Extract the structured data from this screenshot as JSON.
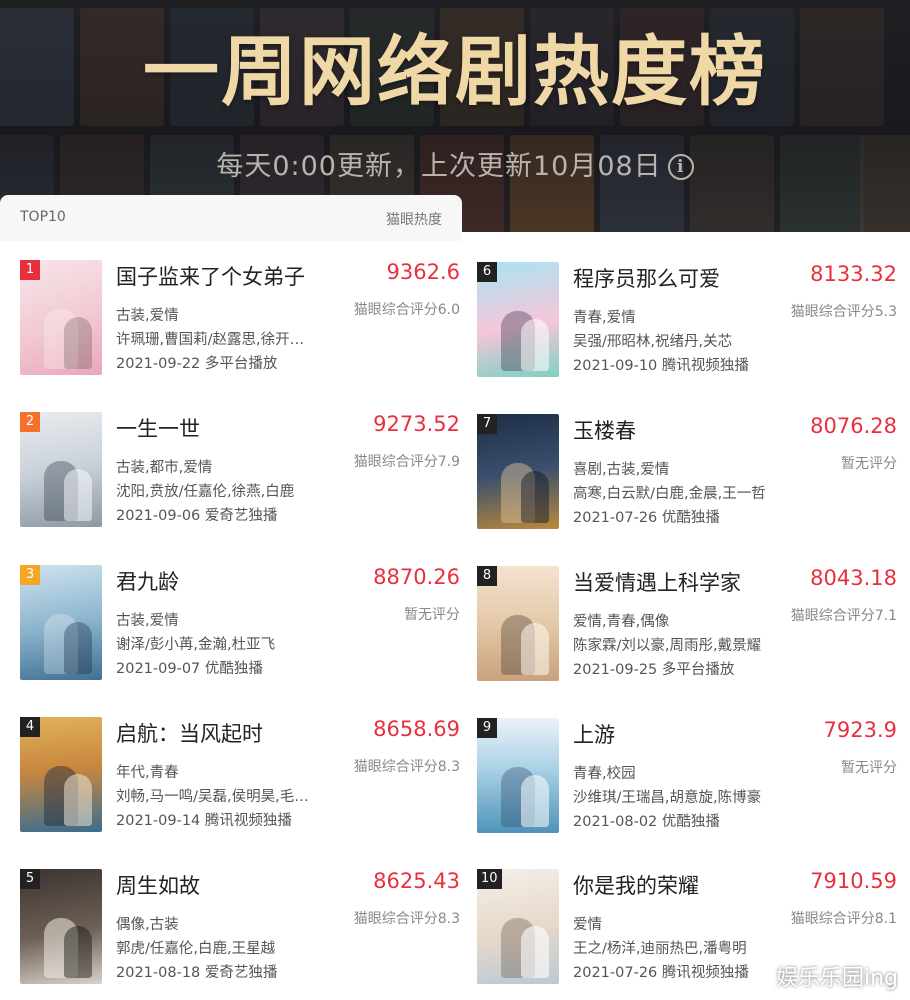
{
  "header": {
    "title": "一周网络剧热度榜",
    "subtitle": "每天0:00更新，上次更新10月08日"
  },
  "tab": {
    "label": "TOP10",
    "metric": "猫眼热度"
  },
  "items": [
    {
      "rank": "1",
      "title": "国子监来了个女弟子",
      "score": "9362.6",
      "rating": "猫眼综合评分6.0",
      "genre": "古装,爱情",
      "cast": "许珮珊,曹国莉/赵露思,徐开…",
      "release": "2021-09-22 多平台播放"
    },
    {
      "rank": "2",
      "title": "一生一世",
      "score": "9273.52",
      "rating": "猫眼综合评分7.9",
      "genre": "古装,都市,爱情",
      "cast": "沈阳,贲放/任嘉伦,徐燕,白鹿",
      "release": "2021-09-06 爱奇艺独播"
    },
    {
      "rank": "3",
      "title": "君九龄",
      "score": "8870.26",
      "rating": "暂无评分",
      "genre": "古装,爱情",
      "cast": "谢泽/彭小苒,金瀚,杜亚飞",
      "release": "2021-09-07 优酷独播"
    },
    {
      "rank": "4",
      "title": "启航：当风起时",
      "score": "8658.69",
      "rating": "猫眼综合评分8.3",
      "genre": "年代,青春",
      "cast": "刘畅,马一鸣/吴磊,侯明昊,毛…",
      "release": "2021-09-14 腾讯视频独播"
    },
    {
      "rank": "5",
      "title": "周生如故",
      "score": "8625.43",
      "rating": "猫眼综合评分8.3",
      "genre": "偶像,古装",
      "cast": "郭虎/任嘉伦,白鹿,王星越",
      "release": "2021-08-18 爱奇艺独播"
    },
    {
      "rank": "6",
      "title": "程序员那么可爱",
      "score": "8133.32",
      "rating": "猫眼综合评分5.3",
      "genre": "青春,爱情",
      "cast": "吴强/邢昭林,祝绪丹,关芯",
      "release": "2021-09-10 腾讯视频独播"
    },
    {
      "rank": "7",
      "title": "玉楼春",
      "score": "8076.28",
      "rating": "暂无评分",
      "genre": "喜剧,古装,爱情",
      "cast": "高寒,白云默/白鹿,金晨,王一哲",
      "release": "2021-07-26 优酷独播"
    },
    {
      "rank": "8",
      "title": "当爱情遇上科学家",
      "score": "8043.18",
      "rating": "猫眼综合评分7.1",
      "genre": "爱情,青春,偶像",
      "cast": "陈家霖/刘以豪,周雨彤,戴景耀",
      "release": "2021-09-25 多平台播放"
    },
    {
      "rank": "9",
      "title": "上游",
      "score": "7923.9",
      "rating": "暂无评分",
      "genre": "青春,校园",
      "cast": "沙维琪/王瑞昌,胡意旋,陈博豪",
      "release": "2021-08-02 优酷独播"
    },
    {
      "rank": "10",
      "title": "你是我的荣耀",
      "score": "7910.59",
      "rating": "猫眼综合评分8.1",
      "genre": "爱情",
      "cast": "王之/杨洋,迪丽热巴,潘粤明",
      "release": "2021-07-26 腾讯视频独播"
    }
  ],
  "watermark": "娱乐乐园ing",
  "colors": {
    "title_gold": "#f0d7a6",
    "score_red": "#e8303d",
    "badge_top1": "#e8303d",
    "badge_top2": "#f5702a",
    "badge_top3": "#f5a623",
    "badge_other": "#222222"
  }
}
